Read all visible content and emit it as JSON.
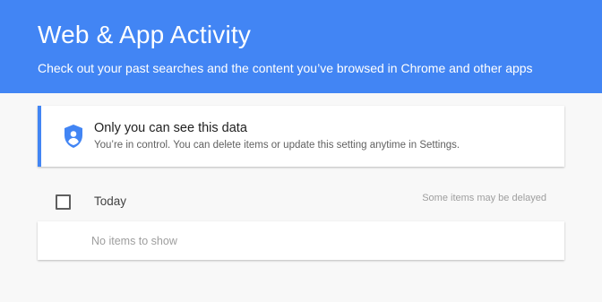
{
  "colors": {
    "header_bg": "#4285f4",
    "accent": "#4285f4",
    "page_bg": "#f8f8f8"
  },
  "header": {
    "title": "Web & App Activity",
    "subtitle": "Check out your past searches and the content you’ve browsed in Chrome and other apps"
  },
  "privacy_notice": {
    "icon": "shield-person-icon",
    "title": "Only you can see this data",
    "description": "You’re in control. You can delete items or update this setting anytime in Settings."
  },
  "activity": {
    "day_label": "Today",
    "delay_note": "Some items may be delayed",
    "empty_message": "No items to show",
    "select_all_checked": false
  }
}
